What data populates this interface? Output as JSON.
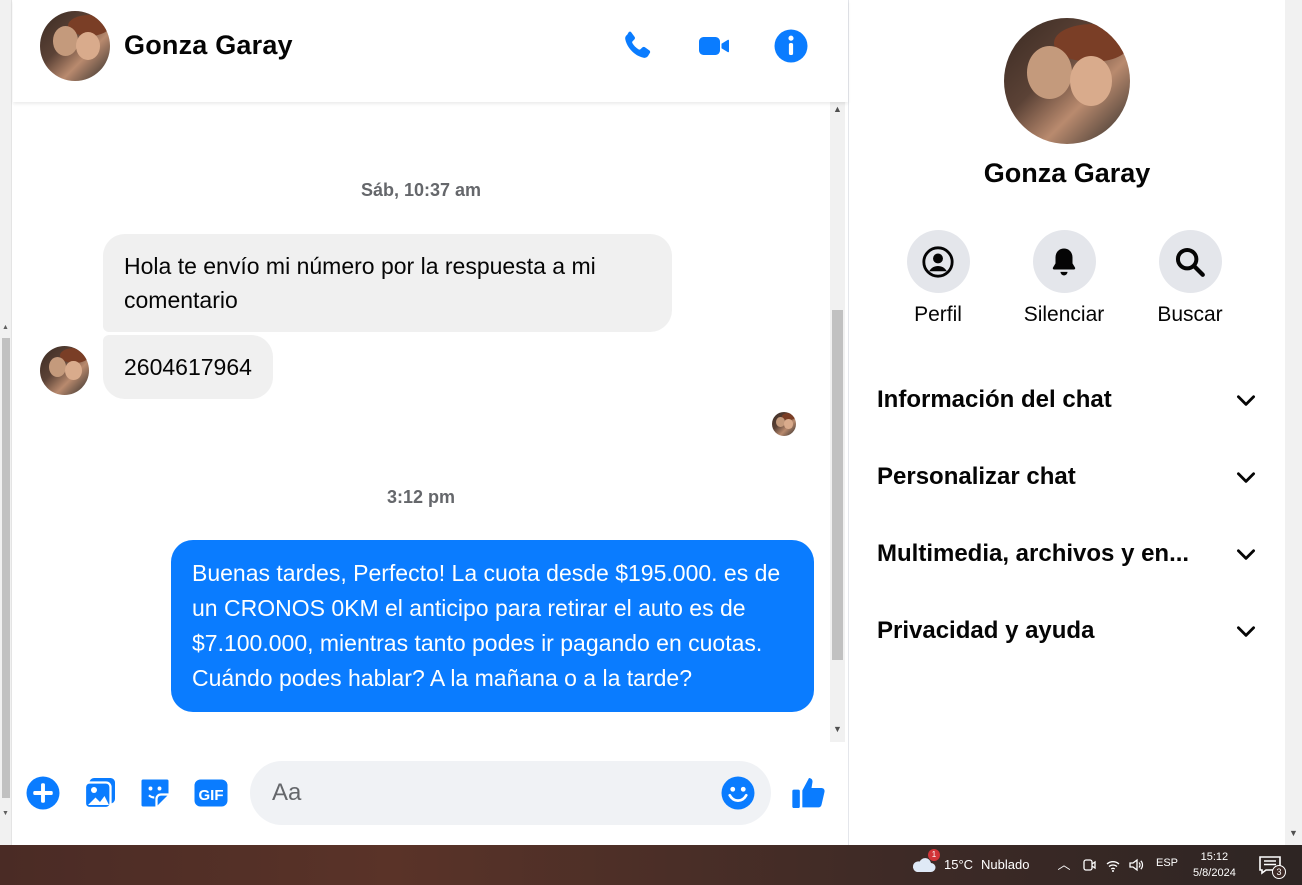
{
  "contact": {
    "name": "Gonza Garay"
  },
  "header": {
    "icons": [
      "phone-icon",
      "video-camera-icon",
      "info-icon"
    ]
  },
  "messages": {
    "timestamp_1": "Sáb, 10:37 am",
    "incoming_1": "Hola te envío mi número por la respuesta a mi comentario",
    "incoming_2": "2604617964",
    "timestamp_2": "3:12 pm",
    "outgoing_1": "Buenas tardes, Perfecto! La cuota desde $195.000. es de un CRONOS 0KM el anticipo para retirar el auto es de $7.100.000, mientras tanto podes ir pagando en cuotas. Cuándo podes hablar? A la mañana o a la tarde?"
  },
  "composer": {
    "placeholder": "Aa",
    "icons": [
      "plus-circle-icon",
      "image-icon",
      "sticker-icon",
      "gif-icon",
      "emoji-icon",
      "thumbs-up-icon"
    ],
    "gif_label": "GIF"
  },
  "panel": {
    "name": "Gonza Garay",
    "actions": [
      {
        "label": "Perfil",
        "icon": "profile-icon"
      },
      {
        "label": "Silenciar",
        "icon": "bell-icon"
      },
      {
        "label": "Buscar",
        "icon": "search-icon"
      }
    ],
    "sections": [
      {
        "title": "Información del chat"
      },
      {
        "title": "Personalizar chat"
      },
      {
        "title": "Multimedia, archivos y en..."
      },
      {
        "title": "Privacidad y ayuda"
      }
    ]
  },
  "taskbar": {
    "weather_temp": "15°C",
    "weather_desc": "Nublado",
    "weather_badge": "1",
    "language": "ESP",
    "time": "15:12",
    "date": "5/8/2024",
    "notifications": "3"
  },
  "colors": {
    "accent": "#0a7cff",
    "incoming_bubble": "#f0f0f0",
    "panel_circle": "#e4e6eb"
  }
}
